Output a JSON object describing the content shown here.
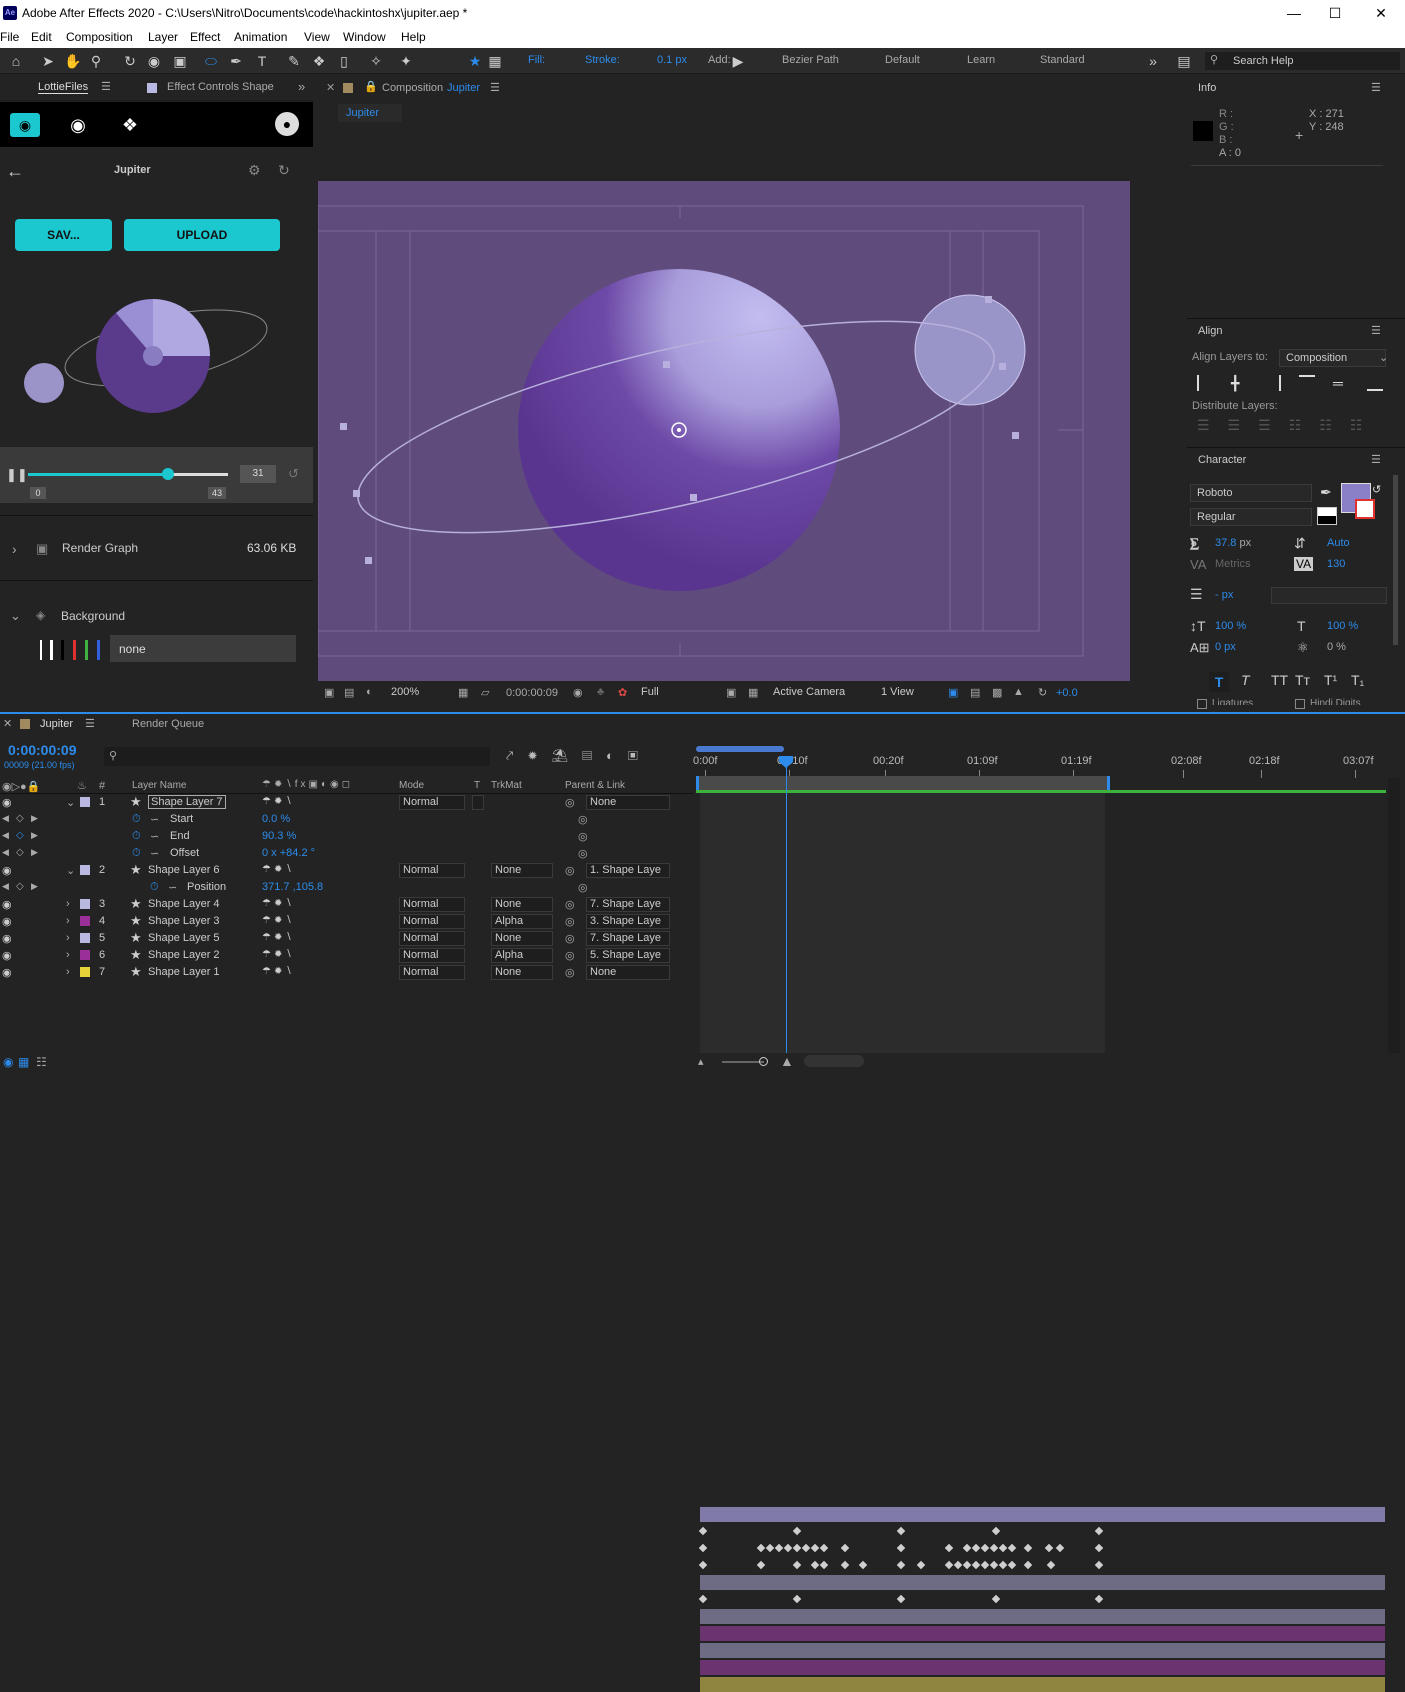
{
  "window": {
    "title": "Adobe After Effects 2020 - C:\\Users\\Nitro\\Documents\\code\\hackintoshx\\jupiter.aep *",
    "icon": "Ae"
  },
  "menu": [
    "File",
    "Edit",
    "Composition",
    "Layer",
    "Effect",
    "Animation",
    "View",
    "Window",
    "Help"
  ],
  "toolbar": {
    "fill_label": "Fill:",
    "stroke_label": "Stroke:",
    "stroke_width": "0.1 px",
    "add_label": "Add:",
    "bezier_label": "Bezier Path",
    "workspaces": [
      "Default",
      "Learn",
      "Standard"
    ],
    "search_placeholder": "Search Help"
  },
  "left_panel": {
    "tabs": [
      "LottieFiles",
      "Effect Controls Shape"
    ],
    "comp_name": "Jupiter",
    "save_btn": "SAV...",
    "upload_btn": "UPLOAD",
    "frame_value": "31",
    "range_start": "0",
    "range_end": "43",
    "playhead_fraction": 0.7,
    "render_graph_label": "Render Graph",
    "render_graph_size": "63.06 KB",
    "background_label": "Background",
    "background_value": "none"
  },
  "composition": {
    "tab_label": "Composition",
    "comp_name": "Jupiter",
    "sub_tab": "Jupiter",
    "zoom": "200%",
    "timecode": "0:00:00:09",
    "quality": "Full",
    "camera": "Active Camera",
    "views": "1 View",
    "exposure": "+0.0"
  },
  "info": {
    "title": "Info",
    "r": "R :",
    "g": "G :",
    "b": "B :",
    "a": "A : 0",
    "x": "X : 271",
    "y": "Y : 248"
  },
  "align": {
    "title": "Align",
    "align_to_label": "Align Layers to:",
    "align_to_value": "Composition",
    "distribute_label": "Distribute Layers:"
  },
  "character": {
    "title": "Character",
    "font": "Roboto",
    "style": "Regular",
    "size": "37.8",
    "size_unit": "px",
    "leading": "Auto",
    "kerning": "Metrics",
    "tracking": "130",
    "stroke_unit": "- px",
    "vscale": "100 %",
    "hscale": "100 %",
    "baseline": "0 px",
    "tsume": "0 %",
    "ligatures": "Ligatures",
    "hindi": "Hindi Digits",
    "fill_color": "#8a80c8"
  },
  "timeline": {
    "tab_label": "Jupiter",
    "render_queue": "Render Queue",
    "timecode": "0:00:00:09",
    "fps": "00009 (21.00 fps)",
    "search_placeholder": "",
    "ruler": [
      "0:00f",
      "00:10f",
      "00:20f",
      "01:09f",
      "01:19f",
      "02:08f",
      "02:18f",
      "03:07f"
    ],
    "headers": {
      "num": "#",
      "name": "Layer Name",
      "mode": "Mode",
      "t": "T",
      "trkmat": "TrkMat",
      "parent": "Parent & Link"
    },
    "rows": [
      {
        "kind": "layer",
        "num": "1",
        "name": "Shape Layer 7",
        "mode": "Normal",
        "trkmat": "",
        "parent": "None",
        "color": "#b8b8e0",
        "bar": "#7f7aa8",
        "selected": true
      },
      {
        "kind": "prop",
        "name": "Start",
        "value": "0.0 %"
      },
      {
        "kind": "prop",
        "name": "End",
        "value": "90.3 %"
      },
      {
        "kind": "prop",
        "name": "Offset",
        "value": "0 x +84.2 °"
      },
      {
        "kind": "layer",
        "num": "2",
        "name": "Shape Layer 6",
        "mode": "Normal",
        "trkmat": "None",
        "parent": "1. Shape Laye",
        "color": "#b8b8e0",
        "bar": "#6e6b85"
      },
      {
        "kind": "prop",
        "name": "Position",
        "value": "371.7 ,105.8"
      },
      {
        "kind": "layer",
        "num": "3",
        "name": "Shape Layer 4",
        "mode": "Normal",
        "trkmat": "None",
        "parent": "7. Shape Laye",
        "color": "#b8b8e0",
        "bar": "#6e6b85"
      },
      {
        "kind": "layer",
        "num": "4",
        "name": "Shape Layer 3",
        "mode": "Normal",
        "trkmat": "Alpha",
        "parent": "3. Shape Laye",
        "color": "#9a2f9a",
        "bar": "#6b3370"
      },
      {
        "kind": "layer",
        "num": "5",
        "name": "Shape Layer 5",
        "mode": "Normal",
        "trkmat": "None",
        "parent": "7. Shape Laye",
        "color": "#b8b8e0",
        "bar": "#6e6b85"
      },
      {
        "kind": "layer",
        "num": "6",
        "name": "Shape Layer 2",
        "mode": "Normal",
        "trkmat": "Alpha",
        "parent": "5. Shape Laye",
        "color": "#9a2f9a",
        "bar": "#6b3370"
      },
      {
        "kind": "layer",
        "num": "7",
        "name": "Shape Layer 1",
        "mode": "Normal",
        "trkmat": "None",
        "parent": "None",
        "color": "#e6d33a",
        "bar": "#8f8540"
      }
    ]
  }
}
